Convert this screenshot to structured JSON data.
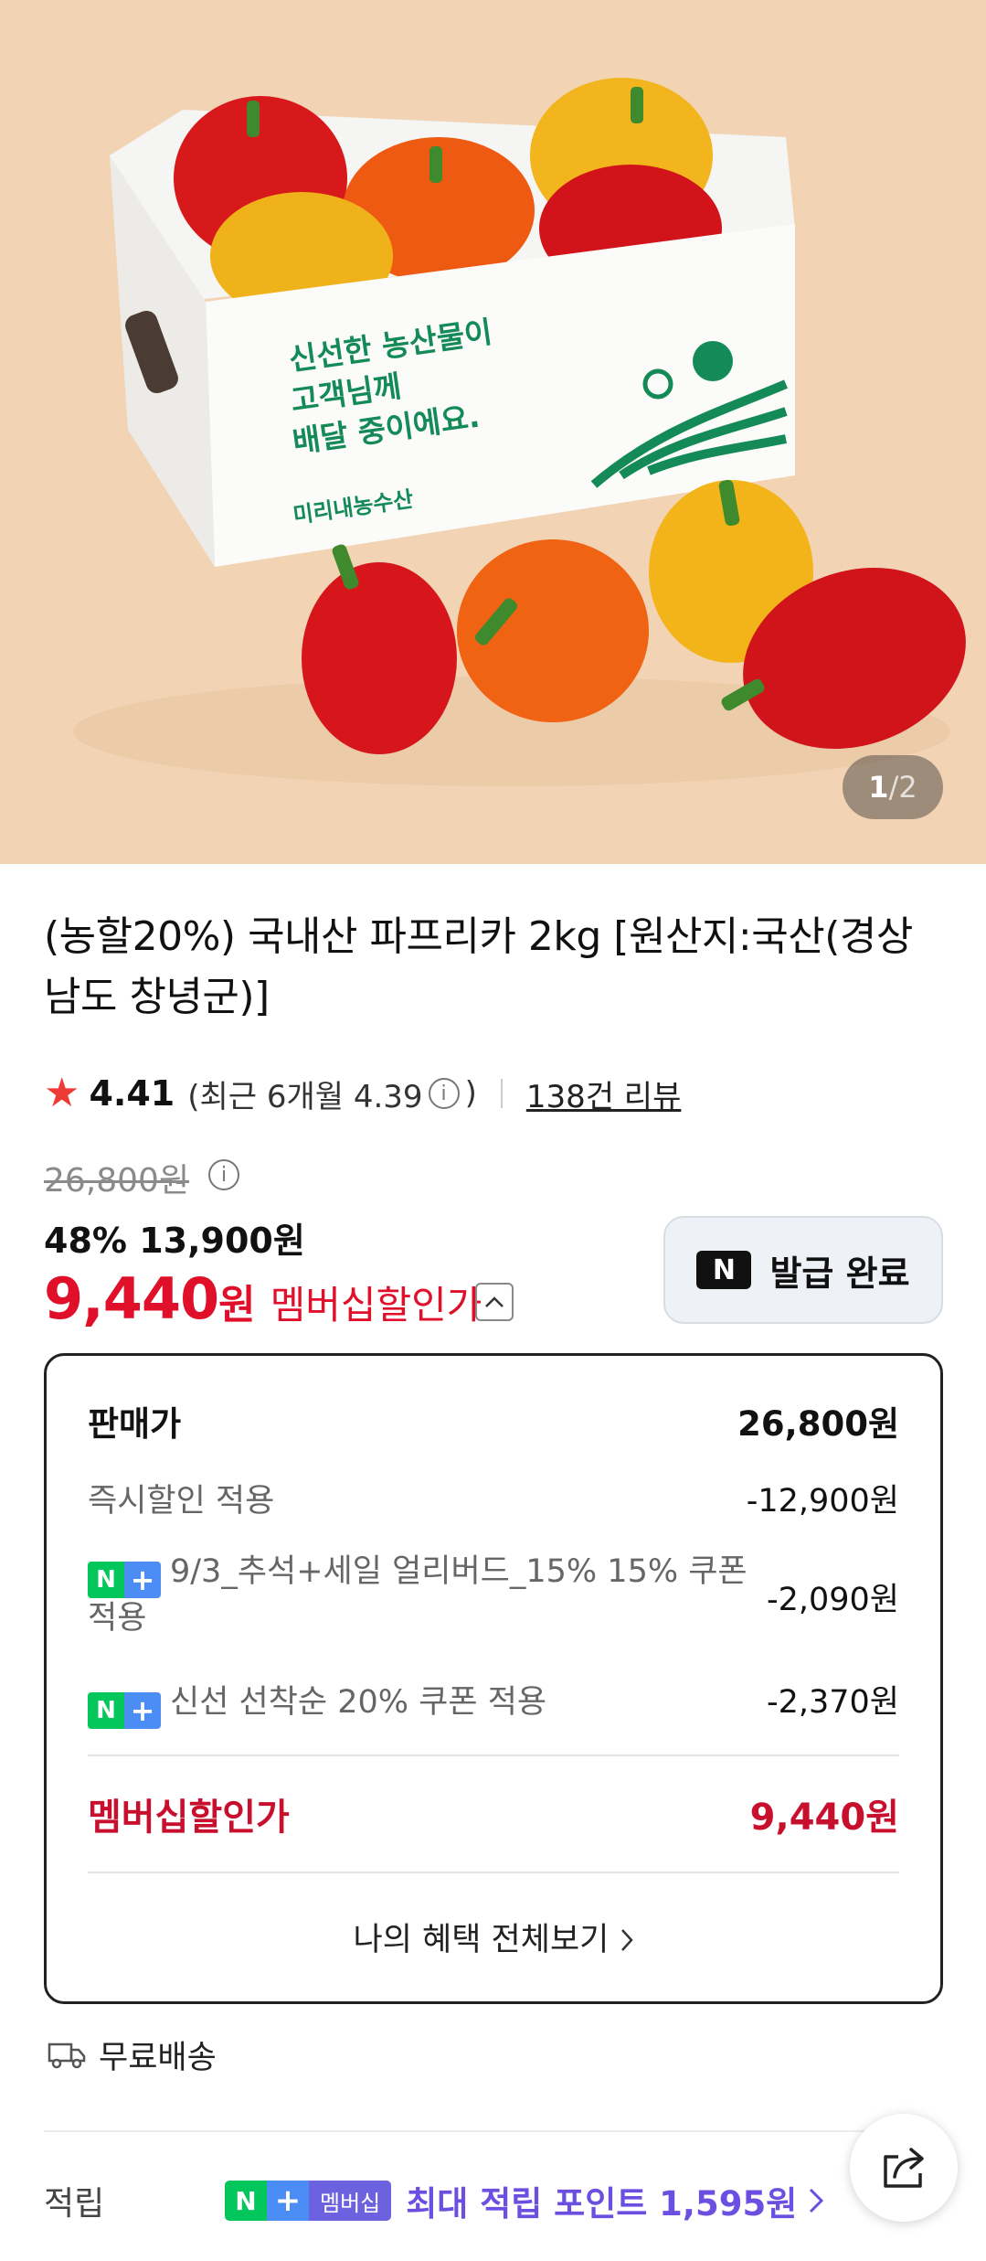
{
  "image": {
    "counter_current": "1",
    "counter_total": "2",
    "box_text_line1": "신선한 농산물이",
    "box_text_line2": "고객님께",
    "box_text_line3": "배달 중이에요.",
    "box_brand": "미리내농수산"
  },
  "product": {
    "title": "(농할20%) 국내산 파프리카 2kg [원산지:국산(경상남도 창녕군)]",
    "rating": "4.41",
    "rating_recent": "(최근 6개월 4.39",
    "rating_recent_close": ")",
    "review_count": "138건 리뷰"
  },
  "price": {
    "original": "26,800원",
    "discount_rate": "48%",
    "sale_price": "13,900원",
    "member_price_number": "9,440",
    "member_price_won": "원",
    "member_price_label": "멤버십할인가"
  },
  "coupon_button": {
    "label": "발급 완료"
  },
  "benefits": {
    "header_label": "판매가",
    "header_value": "26,800원",
    "rows": [
      {
        "label": "즉시할인 적용",
        "value": "-12,900원"
      },
      {
        "label": "9/3_추석+세일 얼리버드_15% 15% 쿠폰 적용",
        "value": "-2,090원"
      },
      {
        "label": "신선 선착순 20% 쿠폰 적용",
        "value": "-2,370원"
      }
    ],
    "total_label": "멤버십할인가",
    "total_value": "9,440원",
    "view_all": "나의 혜택 전체보기"
  },
  "shipping": {
    "label": "무료배송"
  },
  "earn": {
    "label": "적립",
    "badge_member": "멤버십",
    "text": "최대 적립 포인트 1,595원"
  },
  "badge": {
    "n": "N",
    "plus": "+"
  },
  "colors": {
    "accent_red": "#e0102a",
    "star": "#ef3b36",
    "npay_green": "#03c75a",
    "membership_purple": "#6b4fe0"
  }
}
